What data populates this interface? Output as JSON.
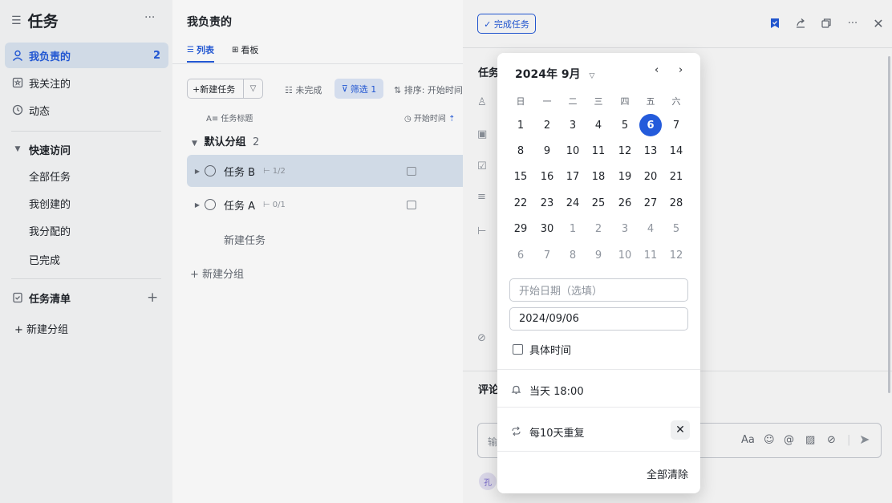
{
  "sidebar": {
    "title": "任务",
    "more": "···",
    "items": [
      {
        "label": "我负责的",
        "count": "2"
      },
      {
        "label": "我关注的"
      },
      {
        "label": "动态"
      }
    ],
    "quick_access": {
      "label": "快速访问",
      "items": [
        "全部任务",
        "我创建的",
        "我分配的",
        "已完成"
      ]
    },
    "task_list": {
      "label": "任务清单",
      "add": "+"
    },
    "new_group": "+ 新建分组"
  },
  "main": {
    "title": "我负责的",
    "tabs": [
      {
        "label": "列表"
      },
      {
        "label": "看板"
      }
    ],
    "toolbar": {
      "new_task": "+新建任务",
      "incomplete": "未完成",
      "filter": "筛选 1",
      "sort": "排序: 开始时间"
    },
    "columns": {
      "title": "任务标题",
      "start_time": "开始时间"
    },
    "group": {
      "name": "默认分组",
      "count": "2"
    },
    "tasks": [
      {
        "name": "任务 B",
        "subtasks": "1/2"
      },
      {
        "name": "任务 A",
        "subtasks": "0/1"
      }
    ],
    "new_task_link": "新建任务",
    "new_group_link": "+ 新建分组"
  },
  "detail": {
    "complete_button": "✓ 完成任务",
    "section_label": "任务",
    "comment_label": "评论",
    "comment_placeholder": "输",
    "font_tool": "Aa",
    "avatar": "孔"
  },
  "datepicker": {
    "month_label": "2024年 9月",
    "weekdays": [
      "日",
      "一",
      "二",
      "三",
      "四",
      "五",
      "六"
    ],
    "weeks": [
      [
        "1",
        "2",
        "3",
        "4",
        "5",
        "6",
        "7"
      ],
      [
        "8",
        "9",
        "10",
        "11",
        "12",
        "13",
        "14"
      ],
      [
        "15",
        "16",
        "17",
        "18",
        "19",
        "20",
        "21"
      ],
      [
        "22",
        "23",
        "24",
        "25",
        "26",
        "27",
        "28"
      ],
      [
        "29",
        "30",
        "1",
        "2",
        "3",
        "4",
        "5"
      ],
      [
        "6",
        "7",
        "8",
        "9",
        "10",
        "11",
        "12"
      ]
    ],
    "selected_day": "6",
    "start_date_placeholder": "开始日期（选填）",
    "due_date": "2024/09/06",
    "specific_time": "具体时间",
    "reminder": "当天 18:00",
    "repeat": "每10天重复",
    "clear_all": "全部清除",
    "accent_color": "#245bdb"
  }
}
